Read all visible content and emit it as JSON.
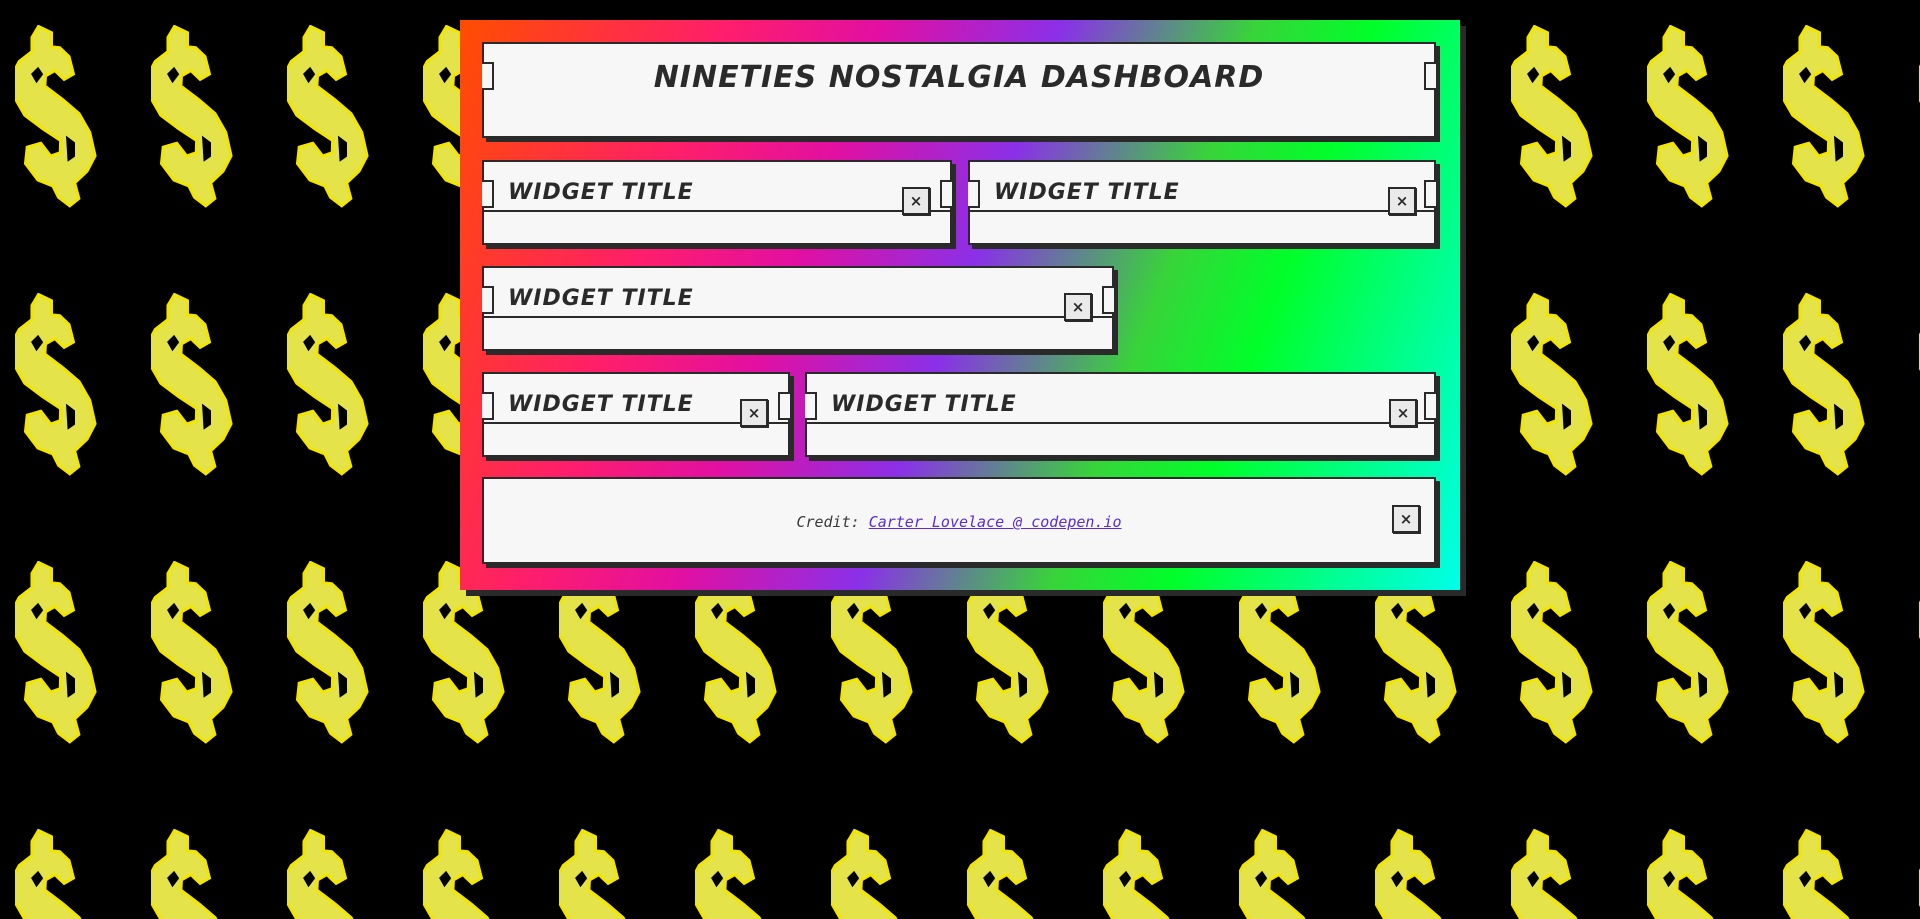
{
  "background": {
    "color": "#000000",
    "pattern_icon": "pixel-dollar-sign-icon",
    "pattern_color": "#e4e44a"
  },
  "header": {
    "title": "Nineties Nostalgia Dashboard"
  },
  "widgets": [
    {
      "title": "Widget Title",
      "close_icon": "close-icon",
      "close_label": "×"
    },
    {
      "title": "Widget Title",
      "close_icon": "close-icon",
      "close_label": "×"
    },
    {
      "title": "Widget Title",
      "close_icon": "close-icon",
      "close_label": "×"
    },
    {
      "title": "Widget Title",
      "close_icon": "close-icon",
      "close_label": "×"
    },
    {
      "title": "Widget Title",
      "close_icon": "close-icon",
      "close_label": "×"
    }
  ],
  "footer": {
    "credit_prefix": "Credit: ",
    "credit_link": "Carter Lovelace @ codepen.io",
    "close_label": "×"
  },
  "colors": {
    "gradient": [
      "#ff4d00",
      "#ff1e6a",
      "#e20fa2",
      "#8a30e8",
      "#39d33a",
      "#00ff2a",
      "#00ffe8"
    ],
    "panel": "#f7f7f7",
    "ink": "#2a2a2a"
  }
}
